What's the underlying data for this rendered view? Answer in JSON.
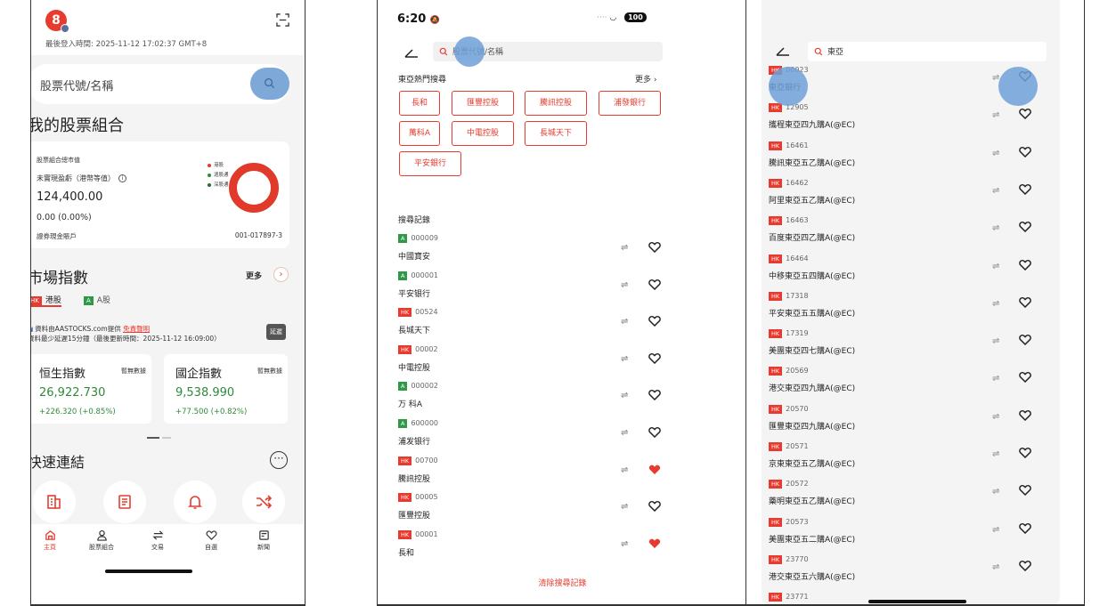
{
  "panel1": {
    "avatar_text": "8",
    "last_login": "最後登入時間: 2025-11-12 17:02:37 GMT+8",
    "search_placeholder": "股票代號/名稱",
    "portfolio_title": "我的股票組合",
    "card": {
      "market_value_label": "股票組合總市值",
      "unrealized_label": "未實現盈虧（港幣等值）",
      "value": "124,400.00",
      "change": "0.00 (0.00%)",
      "account_label": "證券現金賬戶",
      "account_no": "001-017897-3",
      "legend": [
        "港股",
        "滬股通",
        "深股通"
      ]
    },
    "market_title": "市場指數",
    "more_label": "更多",
    "tab_hk_tag": "HK",
    "tab_hk_label": "港股",
    "tab_a_tag": "A",
    "tab_a_label": "A股",
    "source_text": "資料由AASTOCKS.com提供",
    "disclaimer": "免責聲明",
    "delay_text": "資料最少延遲15分鐘（最後更新時間：2025-11-12 16:09:00）",
    "delay_btn": "延遲",
    "indices": [
      {
        "name": "恒生指數",
        "nodata": "暫無數據",
        "value": "26,922.730",
        "change": "+226.320 (+0.85%)"
      },
      {
        "name": "國企指數",
        "nodata": "暫無數據",
        "value": "9,538.990",
        "change": "+77.500 (+0.82%)"
      }
    ],
    "quick_title": "快速連結",
    "nav": [
      "主頁",
      "股票組合",
      "交易",
      "自選",
      "新聞"
    ]
  },
  "panel2": {
    "time": "6:20",
    "battery": "100",
    "search_text": "股票代號/名稱",
    "hot_title": "東亞熱門搜尋",
    "hot_more": "更多",
    "chips": [
      "長和",
      "匯豐控股",
      "騰訊控股",
      "浦發銀行",
      "萬科A",
      "中電控股",
      "長城天下",
      "平安銀行"
    ],
    "history_title": "搜尋記錄",
    "history": [
      {
        "market": "A",
        "code": "000009",
        "name": "中國寶安",
        "fav": false
      },
      {
        "market": "A",
        "code": "000001",
        "name": "平安银行",
        "fav": false
      },
      {
        "market": "HK",
        "code": "00524",
        "name": "長城天下",
        "fav": false
      },
      {
        "market": "HK",
        "code": "00002",
        "name": "中電控股",
        "fav": false
      },
      {
        "market": "A",
        "code": "000002",
        "name": "万 科A",
        "fav": false
      },
      {
        "market": "A",
        "code": "600000",
        "name": "浦发银行",
        "fav": false
      },
      {
        "market": "HK",
        "code": "00700",
        "name": "騰訊控股",
        "fav": true
      },
      {
        "market": "HK",
        "code": "00005",
        "name": "匯豐控股",
        "fav": false
      },
      {
        "market": "HK",
        "code": "00001",
        "name": "長和",
        "fav": true
      }
    ],
    "clear_label": "清除搜尋記錄"
  },
  "panel3": {
    "search_text": "東亞",
    "results": [
      {
        "code": "00023",
        "name": "東亞銀行"
      },
      {
        "code": "12905",
        "name": "攜程東亞四九購A(@EC)"
      },
      {
        "code": "16461",
        "name": "騰訊東亞五乙購A(@EC)"
      },
      {
        "code": "16462",
        "name": "阿里東亞五乙購A(@EC)"
      },
      {
        "code": "16463",
        "name": "百度東亞四乙購A(@EC)"
      },
      {
        "code": "16464",
        "name": "中移東亞五四購A(@EC)"
      },
      {
        "code": "17318",
        "name": "平安東亞五五購A(@EC)"
      },
      {
        "code": "17319",
        "name": "美團東亞四七購A(@EC)"
      },
      {
        "code": "20569",
        "name": "港交東亞四九購A(@EC)"
      },
      {
        "code": "20570",
        "name": "匯豐東亞四九購A(@EC)"
      },
      {
        "code": "20571",
        "name": "京東東亞五乙購A(@EC)"
      },
      {
        "code": "20572",
        "name": "藥明東亞五乙購A(@EC)"
      },
      {
        "code": "20573",
        "name": "美團東亞五二購A(@EC)"
      },
      {
        "code": "23770",
        "name": "港交東亞五六購A(@EC)"
      },
      {
        "code": "23771",
        "name": ""
      }
    ]
  },
  "colors": {
    "accent": "#e63b2e",
    "green": "#2e8a3a",
    "touch": "#7ea8d8"
  }
}
